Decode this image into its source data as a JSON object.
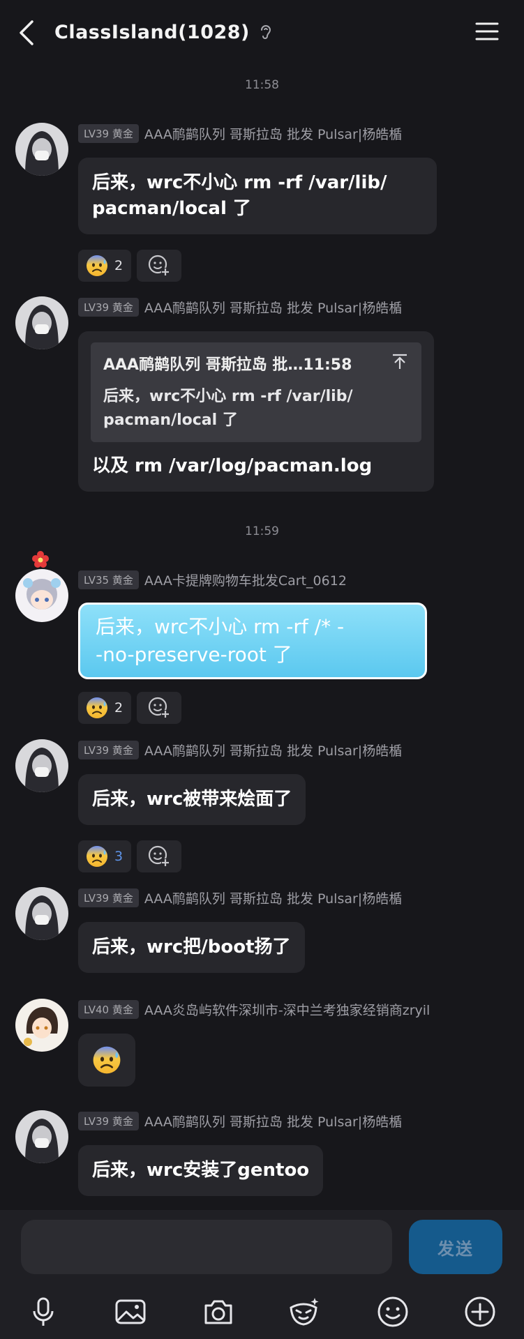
{
  "header": {
    "title": "ClassIsland(1028)"
  },
  "times": [
    "11:58",
    "11:59"
  ],
  "messages": [
    {
      "level": "LV39 黄金",
      "nick": "AAA鸸鹋队列 哥斯拉岛 批发 Pulsar|杨皓楯",
      "text": "后来，wrc不小心 rm -rf /var/lib/\npacman/local 了",
      "reactions": [
        {
          "emoji": "cold-sweat",
          "count": "2"
        }
      ]
    },
    {
      "level": "LV39 黄金",
      "nick": "AAA鸸鹋队列 哥斯拉岛 批发 Pulsar|杨皓楯",
      "quote_author": "AAA鸸鹋队列 哥斯拉岛 批…11:58",
      "quote_text": "后来，wrc不小心 rm -rf /var/lib/\npacman/local 了",
      "text": "以及 rm /var/log/pacman.log"
    },
    {
      "level": "LV35 黄金",
      "nick": "AAA卡提牌购物车批发Cart_0612",
      "text": "后来，wrc不小心 rm -rf /* -\n-no-preserve-root 了",
      "reactions": [
        {
          "emoji": "cold-sweat",
          "count": "2"
        }
      ]
    },
    {
      "level": "LV39 黄金",
      "nick": "AAA鸸鹋队列 哥斯拉岛 批发 Pulsar|杨皓楯",
      "text": "后来，wrc被带来烩面了",
      "reactions": [
        {
          "emoji": "cold-sweat",
          "count": "3"
        }
      ]
    },
    {
      "level": "LV39 黄金",
      "nick": "AAA鸸鹋队列 哥斯拉岛 批发 Pulsar|杨皓楯",
      "text": "后来，wrc把/boot扬了"
    },
    {
      "level": "LV40 黄金",
      "nick": "AAA炎岛屿软件深圳市-深中兰考独家经销商zryil",
      "emoji_only": "cold-sweat"
    },
    {
      "level": "LV39 黄金",
      "nick": "AAA鸸鹋队列 哥斯拉岛 批发 Pulsar|杨皓楯",
      "text": "后来，wrc安装了gentoo"
    }
  ],
  "composer": {
    "send_label": "发送",
    "input_value": ""
  },
  "toolbar": [
    "microphone-icon",
    "image-icon",
    "camera-icon",
    "sticker-icon",
    "emoji-icon",
    "plus-icon"
  ],
  "colors": {
    "background": "#17171b",
    "bubble": "#27272c",
    "accent_blue": "#5bc8ef",
    "send_button": "#155a8c"
  }
}
